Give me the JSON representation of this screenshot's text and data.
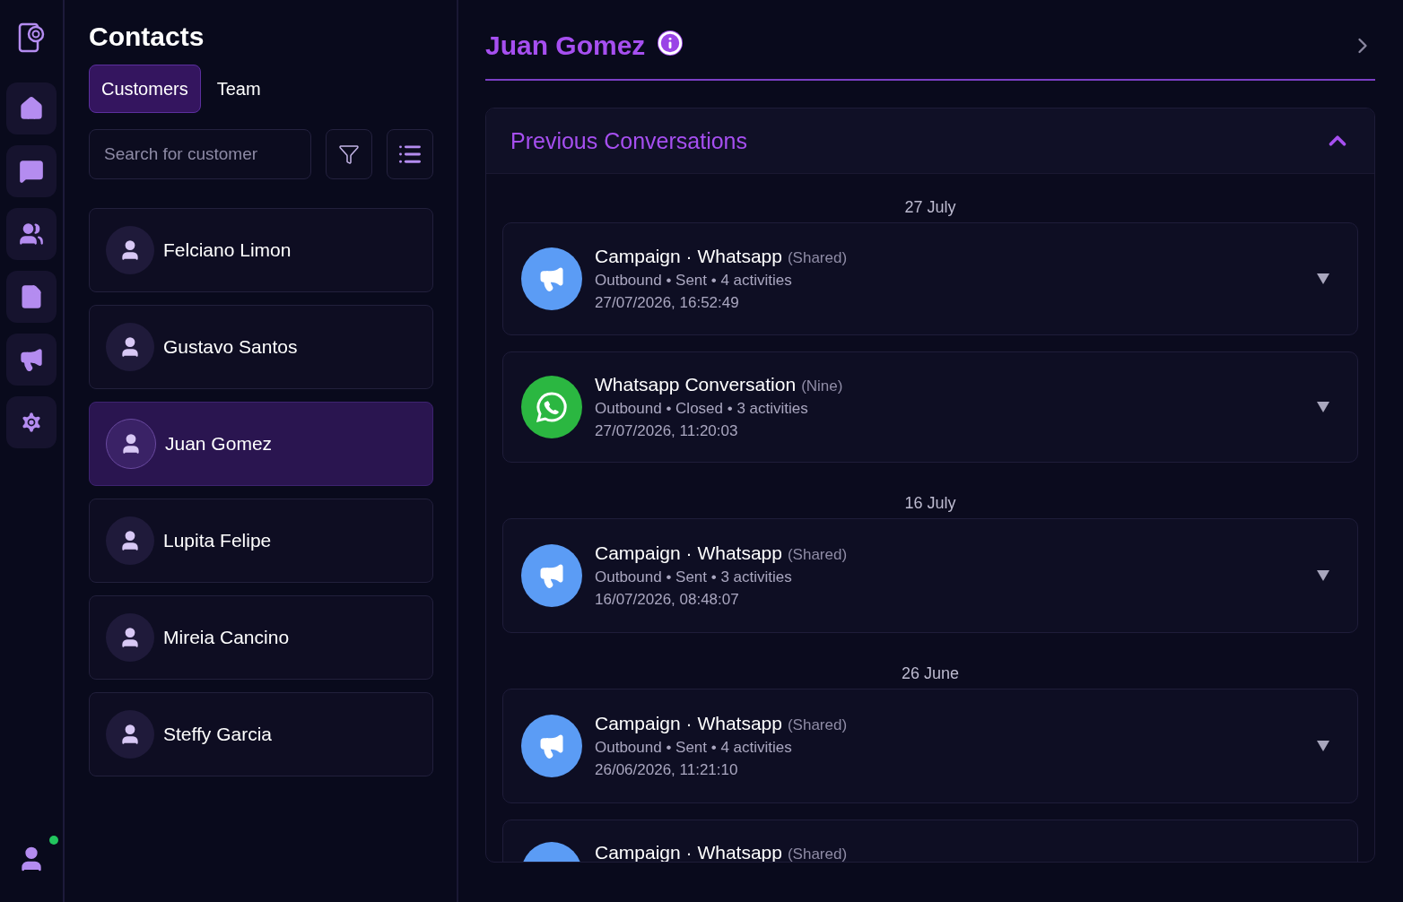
{
  "nav": {
    "items": [
      {
        "kind": "home"
      },
      {
        "kind": "chat"
      },
      {
        "kind": "people"
      },
      {
        "kind": "notes"
      },
      {
        "kind": "campaign"
      },
      {
        "kind": "settings"
      }
    ],
    "user": {
      "online": true
    }
  },
  "contacts": {
    "title": "Contacts",
    "tabs": [
      {
        "label": "Customers",
        "selected": true
      },
      {
        "label": "Team",
        "selected": false
      }
    ],
    "search": {
      "placeholder": "Search for customer"
    },
    "list": [
      {
        "name": "Felciano Limon",
        "selected": false
      },
      {
        "name": "Gustavo Santos",
        "selected": false
      },
      {
        "name": "Juan Gomez",
        "selected": true
      },
      {
        "name": "Lupita Felipe",
        "selected": false
      },
      {
        "name": "Mireia Cancino",
        "selected": false
      },
      {
        "name": "Steffy Garcia",
        "selected": false
      }
    ]
  },
  "detail": {
    "name": "Juan Gomez",
    "section": {
      "title": "Previous Conversations",
      "expanded": true,
      "groups": [
        {
          "date": "27 July",
          "items": [
            {
              "kind": "campaign",
              "title": "Campaign · Whatsapp",
              "tag": "(Shared)",
              "summary": "Outbound • Sent • 4 activities",
              "time": "27/07/2026, 16:52:49"
            },
            {
              "kind": "whatsapp",
              "title": "Whatsapp Conversation",
              "tag": "(Nine)",
              "summary": "Outbound • Closed • 3 activities",
              "time": "27/07/2026, 11:20:03"
            }
          ]
        },
        {
          "date": "16 July",
          "items": [
            {
              "kind": "campaign",
              "title": "Campaign · Whatsapp",
              "tag": "(Shared)",
              "summary": "Outbound • Sent • 3 activities",
              "time": "16/07/2026, 08:48:07"
            }
          ]
        },
        {
          "date": "26 June",
          "items": [
            {
              "kind": "campaign",
              "title": "Campaign · Whatsapp",
              "tag": "(Shared)",
              "summary": "Outbound • Sent • 4 activities",
              "time": "26/06/2026, 11:21:10"
            },
            {
              "kind": "campaign",
              "title": "Campaign · Whatsapp",
              "tag": "(Shared)"
            }
          ]
        }
      ]
    }
  }
}
